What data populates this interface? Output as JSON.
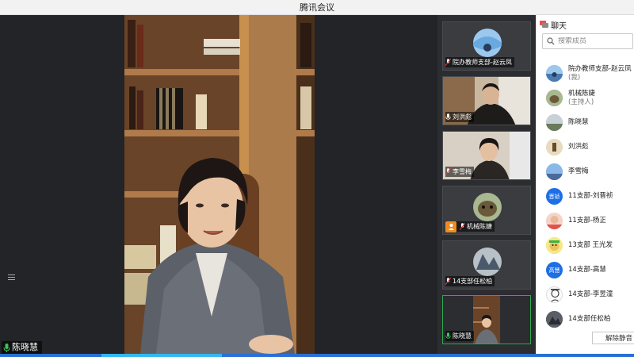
{
  "app": {
    "title": "腾讯会议"
  },
  "main_speaker": {
    "name": "陈晓慧"
  },
  "video_tiles": [
    {
      "name": "院办教师支部-赵云凤",
      "badge": "mic-muted"
    },
    {
      "name": "刘洪彪",
      "badge": "mic"
    },
    {
      "name": "李雪梅",
      "badge": "mic-muted"
    },
    {
      "name": "机械陈婕",
      "badge": "host"
    },
    {
      "name": "14支部任松柏",
      "badge": "mic-muted"
    },
    {
      "name": "陈晓慧",
      "badge": "mic"
    }
  ],
  "panel": {
    "tab_label": "聊天",
    "search_placeholder": "搜索成员",
    "members": [
      {
        "name": "院办教师支部-赵云凤",
        "sub": "(我)",
        "avatar": "sky"
      },
      {
        "name": "机械陈婕",
        "sub": "(主持人)",
        "avatar": "dog"
      },
      {
        "name": "陈晓慧",
        "sub": "",
        "avatar": "landscape"
      },
      {
        "name": "刘洪彪",
        "sub": "",
        "avatar": "figure"
      },
      {
        "name": "李雪梅",
        "sub": "",
        "avatar": "sky2"
      },
      {
        "name": "11支部-刘晋祯",
        "sub": "",
        "avatar": "text",
        "avatar_text": "晋祯"
      },
      {
        "name": "11支部-杨正",
        "sub": "",
        "avatar": "child"
      },
      {
        "name": "13支部 王光发",
        "sub": "",
        "avatar": "cartoon"
      },
      {
        "name": "14支部-高慧",
        "sub": "",
        "avatar": "text",
        "avatar_text": "高慧"
      },
      {
        "name": "14支部-李昱潼",
        "sub": "",
        "avatar": "sketch"
      },
      {
        "name": "14支部任松柏",
        "sub": "",
        "avatar": "dark"
      }
    ],
    "unmute_label": "解除静音"
  },
  "colors": {
    "accent": "#1e6fe6",
    "active_border": "#2fa84f",
    "host_badge": "#f08c1e"
  }
}
